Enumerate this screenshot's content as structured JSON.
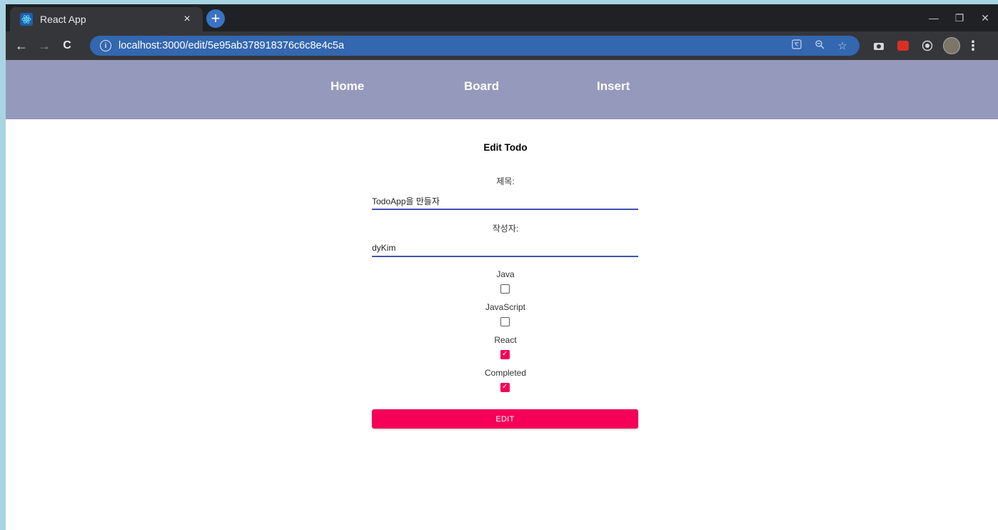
{
  "browser": {
    "tab_title": "React App",
    "tab_close": "×",
    "new_tab": "+",
    "url": "localhost:3000/edit/5e95ab378918376c6c8e4c5a",
    "window_controls": [
      "—",
      "❐",
      "✕"
    ],
    "back": "←",
    "forward": "→",
    "reload": "C",
    "info": "i",
    "kebab": "⋮"
  },
  "nav": {
    "home": "Home",
    "board": "Board",
    "insert": "Insert",
    "bg_color": "#9599bb"
  },
  "form": {
    "title": "Edit Todo",
    "title_label": "제목:",
    "title_value": "TodoApp을 만들자",
    "author_label": "작성자:",
    "author_value": "dyKim",
    "checkboxes": [
      {
        "label": "Java",
        "checked": false
      },
      {
        "label": "JavaScript",
        "checked": false
      },
      {
        "label": "React",
        "checked": true
      },
      {
        "label": "Completed",
        "checked": true
      }
    ],
    "submit_label": "EDIT",
    "accent": "#f50057",
    "underline": "#3f51b5"
  }
}
